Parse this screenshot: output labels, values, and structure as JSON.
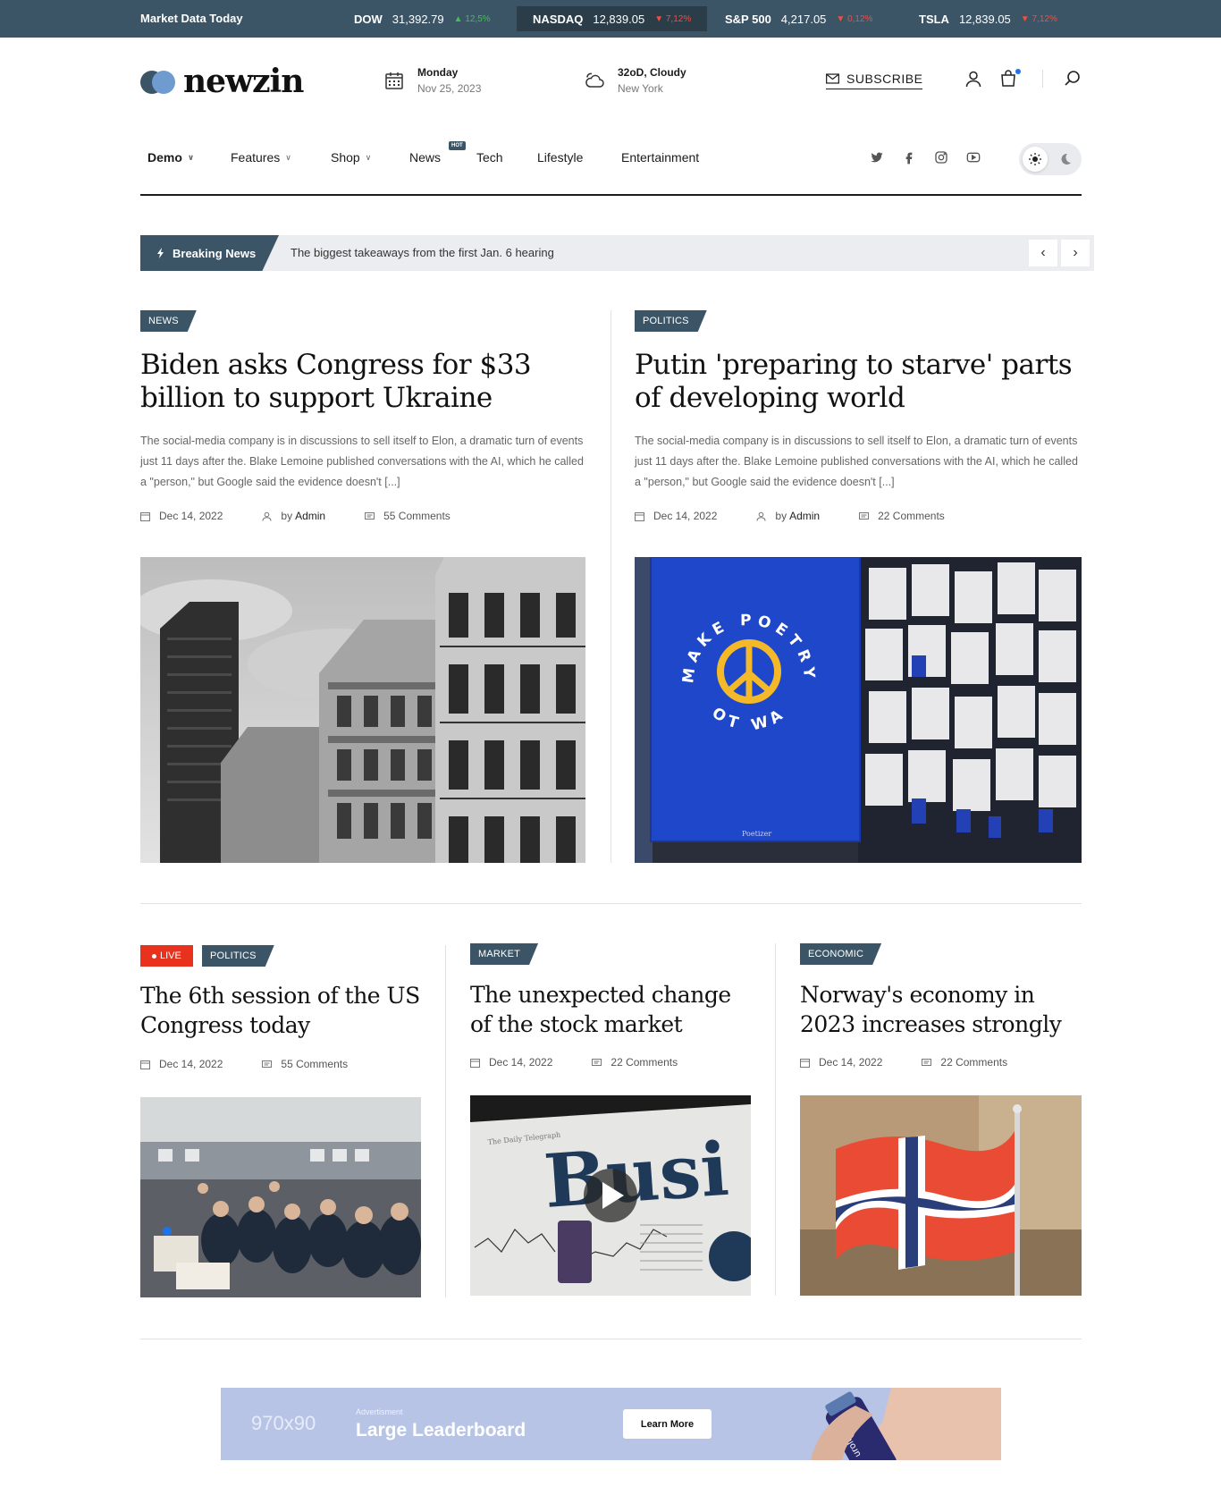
{
  "ticker": {
    "label": "Market Data Today",
    "items": [
      {
        "symbol": "DOW",
        "value": "31,392.79",
        "change": "12,5%",
        "direction": "up"
      },
      {
        "symbol": "NASDAQ",
        "value": "12,839.05",
        "change": "7,12%",
        "direction": "down"
      },
      {
        "symbol": "S&P 500",
        "value": "4,217.05",
        "change": "0,12%",
        "direction": "down"
      },
      {
        "symbol": "TSLA",
        "value": "12,839.05",
        "change": "7,12%",
        "direction": "down"
      }
    ]
  },
  "header": {
    "logo": "newzin",
    "date": {
      "day": "Monday",
      "date": "Nov 25, 2023"
    },
    "weather": {
      "condition": "32oD, Cloudy",
      "city": "New York"
    },
    "subscribe_label": "SUBSCRIBE"
  },
  "nav": {
    "items": [
      {
        "label": "Demo"
      },
      {
        "label": "Features"
      },
      {
        "label": "Shop"
      },
      {
        "label": "News"
      },
      {
        "label": "Tech"
      },
      {
        "label": "Lifestyle"
      },
      {
        "label": "Entertainment"
      }
    ],
    "hot_badge": "HOT"
  },
  "breaking": {
    "label": "Breaking News",
    "headline": "The biggest takeaways from the first Jan. 6 hearing"
  },
  "featured": [
    {
      "category": "NEWS",
      "title": "Biden asks Congress for $33 billion to support Ukraine",
      "excerpt": "The social-media company is in discussions to sell itself to Elon, a dramatic turn of events just 11 days after the. Blake Lemoine published conversations with the AI, which he called a \"person,\" but Google said the evidence doesn't [...]",
      "date": "Dec 14, 2022",
      "author_prefix": "by",
      "author": "Admin",
      "comments": "55 Comments"
    },
    {
      "category": "POLITICS",
      "title": "Putin 'preparing to starve' parts of developing world",
      "excerpt": "The social-media company is in discussions to sell itself to Elon, a dramatic turn of events just 11 days after the. Blake Lemoine published conversations with the AI, which he called a \"person,\" but Google said the evidence doesn't [...]",
      "date": "Dec 14, 2022",
      "author_prefix": "by",
      "author": "Admin",
      "comments": "22 Comments",
      "image_text": {
        "arc_top": "MAKE POETRY",
        "arc_bottom": "NOT WAR",
        "brand": "Poetizer"
      }
    }
  ],
  "cards": [
    {
      "live_label": "LIVE",
      "category": "POLITICS",
      "title": "The 6th session of the US Congress today",
      "date": "Dec 14, 2022",
      "comments": "55 Comments"
    },
    {
      "category": "MARKET",
      "title": "The unexpected change of the stock market",
      "date": "Dec 14, 2022",
      "comments": "22 Comments",
      "image_text": {
        "masthead": "The Daily Telegraph",
        "headline": "Busi"
      }
    },
    {
      "category": "ECONOMIC",
      "title": "Norway's economy in 2023 increases strongly",
      "date": "Dec 14, 2022",
      "comments": "22 Comments"
    }
  ],
  "ad": {
    "size": "970x90",
    "kicker": "Advertisment",
    "title": "Large Leaderboard",
    "button": "Learn More",
    "product": "urology"
  },
  "colors": {
    "brand": "#3c5566",
    "accent_blue": "#6f9bcf",
    "live_red": "#e8321e",
    "up_green": "#3fbf54",
    "down_red": "#f04e3e"
  }
}
